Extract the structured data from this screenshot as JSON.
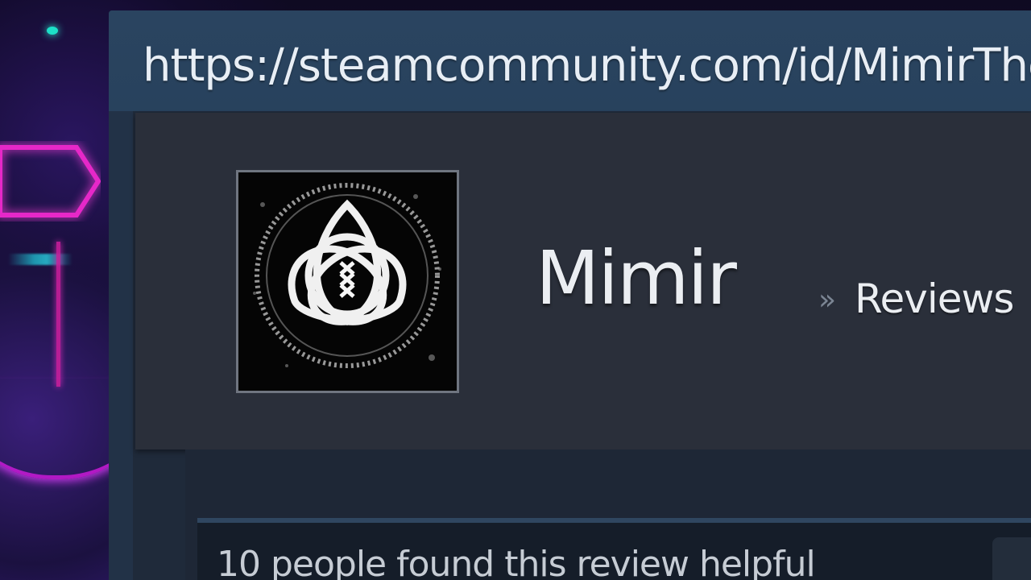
{
  "browser": {
    "url": "https://steamcommunity.com/id/MimirThe"
  },
  "profile": {
    "name": "Mimir",
    "avatar_icon": "triquetra-rune-circle-icon",
    "breadcrumb_separator": "»",
    "breadcrumb_section": "Reviews",
    "breadcrumb_trailing_separator": "»"
  },
  "review": {
    "helpful_text": "10 people found this review helpful"
  },
  "colors": {
    "url_bar": "#2a4460",
    "page_bg": "#1b2838",
    "header_bg": "#2a2f3a",
    "text_primary": "#ebeef2",
    "text_muted": "#7c8694"
  }
}
